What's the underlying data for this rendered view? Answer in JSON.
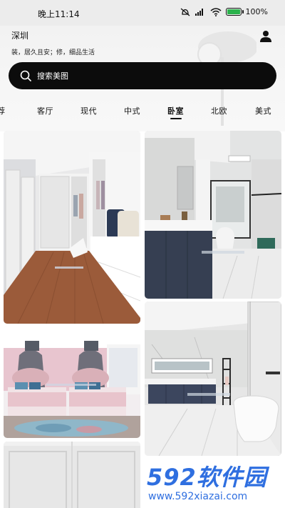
{
  "status_bar": {
    "time": "晚上11:14",
    "battery": "100%"
  },
  "header": {
    "city": "深圳",
    "slogan": "装，居久且安；修，细品生活",
    "search_placeholder": "搜索美图"
  },
  "tabs": [
    {
      "label": "荐"
    },
    {
      "label": "客厅"
    },
    {
      "label": "现代"
    },
    {
      "label": "中式"
    },
    {
      "label": "卧室",
      "active": true
    },
    {
      "label": "北欧"
    },
    {
      "label": "美式"
    }
  ],
  "gallery": [
    {
      "name": "walk-in-closet"
    },
    {
      "name": "bathroom-vanity"
    },
    {
      "name": "bedroom-twin-beds"
    },
    {
      "name": "bathroom-toilet"
    },
    {
      "name": "white-wall-panel"
    }
  ],
  "watermark": {
    "logo_num": "592",
    "logo_cn": "软件园",
    "url": "www.592xiazai.com"
  },
  "colors": {
    "accent": "#2f6fe0",
    "search_bg": "#0c0c0c"
  }
}
